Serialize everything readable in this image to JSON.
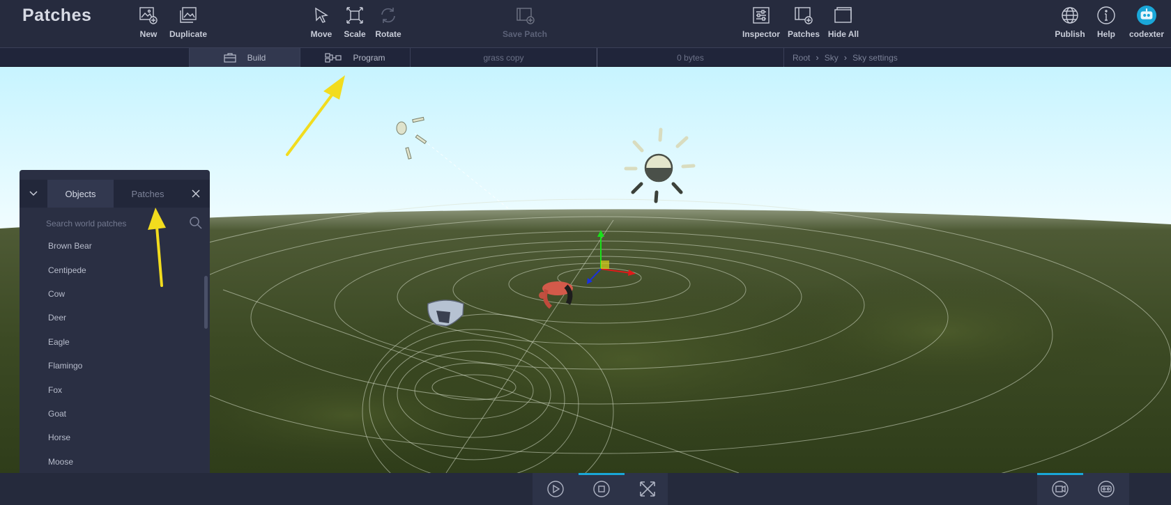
{
  "app": {
    "title": "Patches"
  },
  "toolbar": {
    "new": "New",
    "duplicate": "Duplicate",
    "move": "Move",
    "scale": "Scale",
    "rotate": "Rotate",
    "save_patch": "Save Patch",
    "inspector": "Inspector",
    "patches": "Patches",
    "hide_all": "Hide All",
    "publish": "Publish",
    "help": "Help",
    "user": "codexter"
  },
  "subbar": {
    "build": "Build",
    "program": "Program",
    "patch_name": "grass copy",
    "size": "0 bytes",
    "breadcrumb": [
      "Root",
      "Sky",
      "Sky settings"
    ]
  },
  "panel": {
    "tabs": [
      "Objects",
      "Patches"
    ],
    "active_tab": "Objects",
    "search_placeholder": "Search world patches",
    "items": [
      "Brown Bear",
      "Centipede",
      "Cow",
      "Deer",
      "Eagle",
      "Flamingo",
      "Fox",
      "Goat",
      "Horse",
      "Moose"
    ]
  },
  "colors": {
    "accent": "#1aa7d8",
    "annotation_arrow": "#f2dc1e",
    "toolbar_bg": "#262b3e"
  }
}
